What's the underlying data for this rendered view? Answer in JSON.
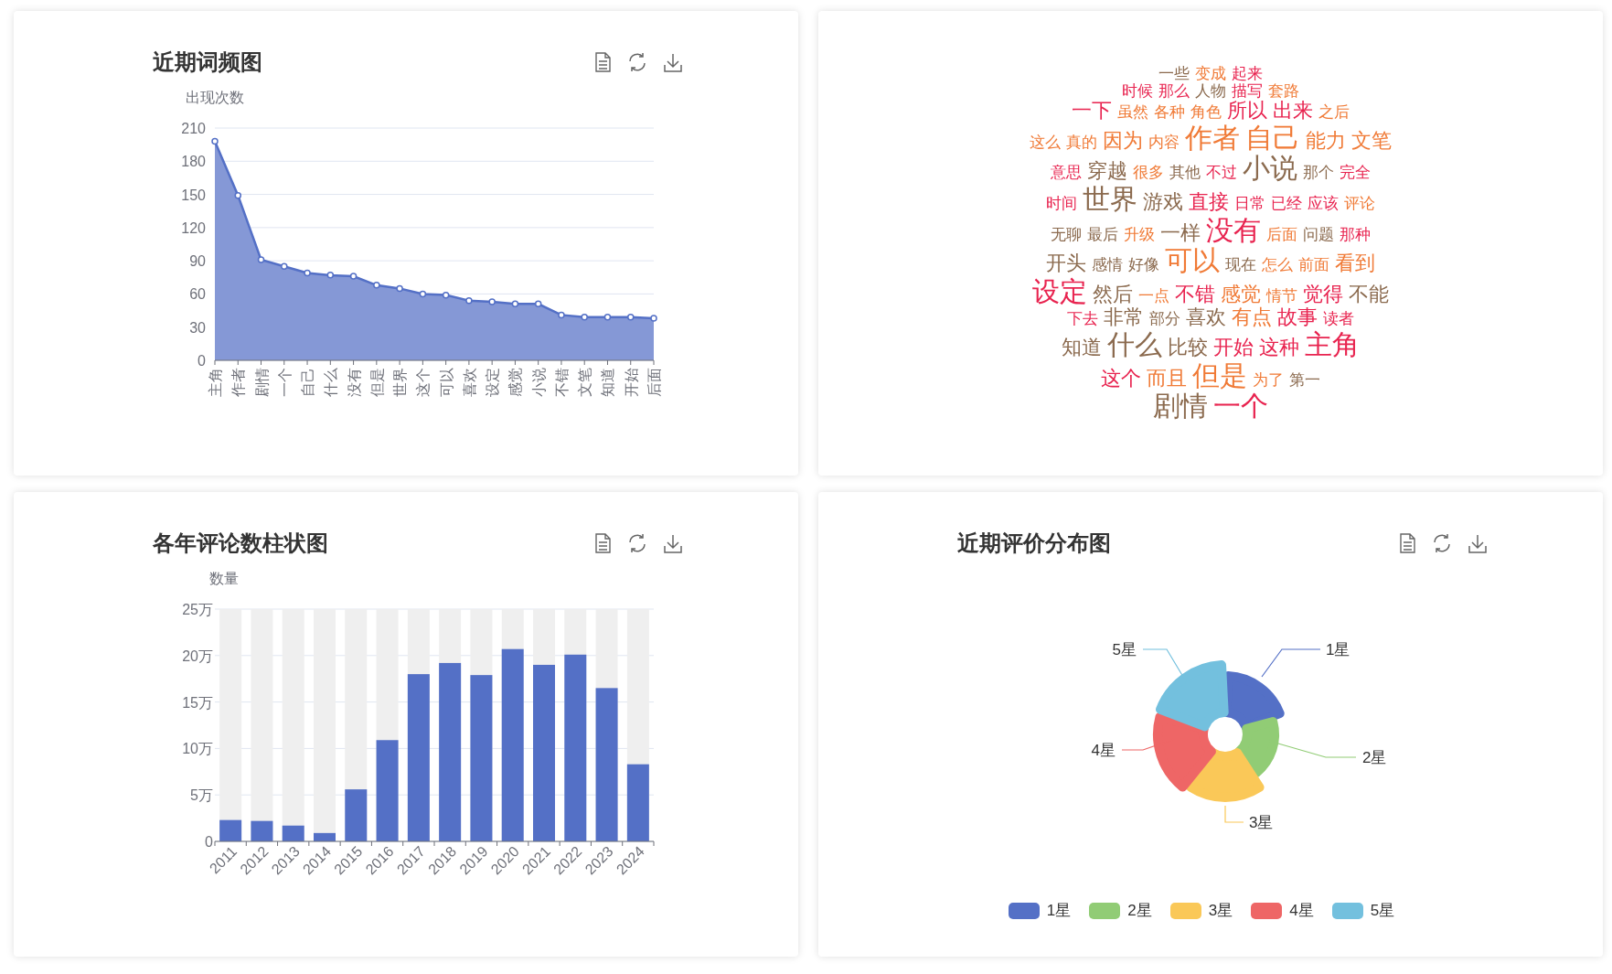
{
  "word_frequency_chart": {
    "title": "近期词频图",
    "chart_data": {
      "type": "area",
      "ylabel": "出现次数",
      "categories": [
        "主角",
        "作者",
        "剧情",
        "一个",
        "自己",
        "什么",
        "没有",
        "但是",
        "世界",
        "这个",
        "可以",
        "喜欢",
        "设定",
        "感觉",
        "小说",
        "不错",
        "文笔",
        "知道",
        "开始",
        "后面"
      ],
      "values": [
        198,
        149,
        91,
        85,
        79,
        77,
        76,
        68,
        65,
        60,
        59,
        54,
        53,
        51,
        51,
        41,
        39,
        39,
        39,
        38
      ],
      "ylim": [
        0,
        210
      ],
      "yticks": [
        0,
        30,
        60,
        90,
        120,
        150,
        180,
        210
      ],
      "grid": true
    }
  },
  "word_cloud": {
    "words": [
      {
        "text": "一些",
        "color": "#8b6a4e",
        "kind": "small"
      },
      {
        "text": "变成",
        "color": "#f07a36",
        "kind": "small"
      },
      {
        "text": "起来",
        "color": "#e8234f",
        "kind": "small"
      },
      {
        "text": "时候",
        "color": "#e8234f",
        "kind": "small"
      },
      {
        "text": "那么",
        "color": "#e8234f",
        "kind": "small"
      },
      {
        "text": "人物",
        "color": "#8b6a4e",
        "kind": "small"
      },
      {
        "text": "描写",
        "color": "#e8234f",
        "kind": "small"
      },
      {
        "text": "套路",
        "color": "#f07a36",
        "kind": "small"
      },
      {
        "text": "一下",
        "color": "#e8234f",
        "kind": "medium"
      },
      {
        "text": "虽然",
        "color": "#f07a36",
        "kind": "small"
      },
      {
        "text": "各种",
        "color": "#f07a36",
        "kind": "small"
      },
      {
        "text": "角色",
        "color": "#f07a36",
        "kind": "small"
      },
      {
        "text": "所以",
        "color": "#e8234f",
        "kind": "medium"
      },
      {
        "text": "出来",
        "color": "#e8234f",
        "kind": "medium"
      },
      {
        "text": "之后",
        "color": "#f07a36",
        "kind": "small"
      },
      {
        "text": "这么",
        "color": "#f07a36",
        "kind": "small"
      },
      {
        "text": "真的",
        "color": "#f07a36",
        "kind": "small"
      },
      {
        "text": "因为",
        "color": "#f07a36",
        "kind": "medium"
      },
      {
        "text": "内容",
        "color": "#f07a36",
        "kind": "small"
      },
      {
        "text": "作者",
        "color": "#f07a36",
        "kind": "large"
      },
      {
        "text": "自己",
        "color": "#f07a36",
        "kind": "large"
      },
      {
        "text": "能力",
        "color": "#f07a36",
        "kind": "medium"
      },
      {
        "text": "文笔",
        "color": "#f07a36",
        "kind": "medium"
      },
      {
        "text": "意思",
        "color": "#e8234f",
        "kind": "small"
      },
      {
        "text": "穿越",
        "color": "#8b6a4e",
        "kind": "medium"
      },
      {
        "text": "很多",
        "color": "#f07a36",
        "kind": "small"
      },
      {
        "text": "其他",
        "color": "#8b6a4e",
        "kind": "small"
      },
      {
        "text": "不过",
        "color": "#e8234f",
        "kind": "small"
      },
      {
        "text": "小说",
        "color": "#8b6a4e",
        "kind": "large"
      },
      {
        "text": "那个",
        "color": "#8b6a4e",
        "kind": "small"
      },
      {
        "text": "完全",
        "color": "#e8234f",
        "kind": "small"
      },
      {
        "text": "时间",
        "color": "#e8234f",
        "kind": "small"
      },
      {
        "text": "世界",
        "color": "#8b6a4e",
        "kind": "large"
      },
      {
        "text": "游戏",
        "color": "#8b6a4e",
        "kind": "medium"
      },
      {
        "text": "直接",
        "color": "#e8234f",
        "kind": "medium"
      },
      {
        "text": "日常",
        "color": "#e8234f",
        "kind": "small"
      },
      {
        "text": "已经",
        "color": "#e8234f",
        "kind": "small"
      },
      {
        "text": "应该",
        "color": "#e8234f",
        "kind": "small"
      },
      {
        "text": "评论",
        "color": "#f07a36",
        "kind": "small"
      },
      {
        "text": "无聊",
        "color": "#8b6a4e",
        "kind": "small"
      },
      {
        "text": "最后",
        "color": "#8b6a4e",
        "kind": "small"
      },
      {
        "text": "升级",
        "color": "#f07a36",
        "kind": "small"
      },
      {
        "text": "一样",
        "color": "#8b6a4e",
        "kind": "medium"
      },
      {
        "text": "没有",
        "color": "#e8234f",
        "kind": "large"
      },
      {
        "text": "后面",
        "color": "#f07a36",
        "kind": "small"
      },
      {
        "text": "问题",
        "color": "#8b6a4e",
        "kind": "small"
      },
      {
        "text": "那种",
        "color": "#e8234f",
        "kind": "small"
      },
      {
        "text": "开头",
        "color": "#8b6a4e",
        "kind": "medium"
      },
      {
        "text": "感情",
        "color": "#8b6a4e",
        "kind": "small"
      },
      {
        "text": "好像",
        "color": "#8b6a4e",
        "kind": "small"
      },
      {
        "text": "可以",
        "color": "#f07a36",
        "kind": "large"
      },
      {
        "text": "现在",
        "color": "#8b6a4e",
        "kind": "small"
      },
      {
        "text": "怎么",
        "color": "#f07a36",
        "kind": "small"
      },
      {
        "text": "前面",
        "color": "#f07a36",
        "kind": "small"
      },
      {
        "text": "看到",
        "color": "#f07a36",
        "kind": "medium"
      },
      {
        "text": "设定",
        "color": "#e8234f",
        "kind": "large"
      },
      {
        "text": "然后",
        "color": "#8b6a4e",
        "kind": "medium"
      },
      {
        "text": "一点",
        "color": "#f07a36",
        "kind": "small"
      },
      {
        "text": "不错",
        "color": "#e8234f",
        "kind": "medium"
      },
      {
        "text": "感觉",
        "color": "#f07a36",
        "kind": "medium"
      },
      {
        "text": "情节",
        "color": "#f07a36",
        "kind": "small"
      },
      {
        "text": "觉得",
        "color": "#e8234f",
        "kind": "medium"
      },
      {
        "text": "不能",
        "color": "#8b6a4e",
        "kind": "medium"
      },
      {
        "text": "下去",
        "color": "#e8234f",
        "kind": "small"
      },
      {
        "text": "非常",
        "color": "#8b6a4e",
        "kind": "medium"
      },
      {
        "text": "部分",
        "color": "#8b6a4e",
        "kind": "small"
      },
      {
        "text": "喜欢",
        "color": "#8b6a4e",
        "kind": "medium"
      },
      {
        "text": "有点",
        "color": "#f07a36",
        "kind": "medium"
      },
      {
        "text": "故事",
        "color": "#e8234f",
        "kind": "medium"
      },
      {
        "text": "读者",
        "color": "#e8234f",
        "kind": "small"
      },
      {
        "text": "知道",
        "color": "#8b6a4e",
        "kind": "medium"
      },
      {
        "text": "什么",
        "color": "#8b6a4e",
        "kind": "large"
      },
      {
        "text": "比较",
        "color": "#8b6a4e",
        "kind": "medium"
      },
      {
        "text": "开始",
        "color": "#e8234f",
        "kind": "medium"
      },
      {
        "text": "这种",
        "color": "#e8234f",
        "kind": "medium"
      },
      {
        "text": "主角",
        "color": "#e8234f",
        "kind": "large"
      },
      {
        "text": "这个",
        "color": "#e8234f",
        "kind": "medium"
      },
      {
        "text": "而且",
        "color": "#f07a36",
        "kind": "medium"
      },
      {
        "text": "但是",
        "color": "#f07a36",
        "kind": "large"
      },
      {
        "text": "为了",
        "color": "#f07a36",
        "kind": "small"
      },
      {
        "text": "第一",
        "color": "#8b6a4e",
        "kind": "small"
      },
      {
        "text": "剧情",
        "color": "#8b6a4e",
        "kind": "large"
      },
      {
        "text": "一个",
        "color": "#e8234f",
        "kind": "large"
      }
    ]
  },
  "yearly_comments_chart": {
    "title": "各年评论数柱状图",
    "chart_data": {
      "type": "bar",
      "ylabel": "数量",
      "categories": [
        "2011",
        "2012",
        "2013",
        "2014",
        "2015",
        "2016",
        "2017",
        "2018",
        "2019",
        "2020",
        "2021",
        "2022",
        "2023",
        "2024"
      ],
      "values": [
        2.3,
        2.2,
        1.7,
        0.9,
        5.6,
        10.9,
        18.0,
        19.2,
        17.9,
        20.7,
        19.0,
        20.1,
        16.5,
        8.3
      ],
      "ylim": [
        0,
        25
      ],
      "yticks": [
        {
          "value": 0,
          "label": "0"
        },
        {
          "value": 5,
          "label": "5万"
        },
        {
          "value": 10,
          "label": "10万"
        },
        {
          "value": 15,
          "label": "15万"
        },
        {
          "value": 20,
          "label": "20万"
        },
        {
          "value": 25,
          "label": "25万"
        }
      ],
      "grid": true
    }
  },
  "rating_chart": {
    "title": "近期评价分布图",
    "slices": [
      {
        "label": "1星",
        "color": "#5470c6"
      },
      {
        "label": "2星",
        "color": "#91cc75"
      },
      {
        "label": "3星",
        "color": "#fac858"
      },
      {
        "label": "4星",
        "color": "#ee6666"
      },
      {
        "label": "5星",
        "color": "#73c0de"
      }
    ],
    "legend": [
      {
        "label": "1星",
        "color": "#5470c6"
      },
      {
        "label": "2星",
        "color": "#91cc75"
      },
      {
        "label": "3星",
        "color": "#fac858"
      },
      {
        "label": "4星",
        "color": "#ee6666"
      },
      {
        "label": "5星",
        "color": "#73c0de"
      }
    ]
  }
}
